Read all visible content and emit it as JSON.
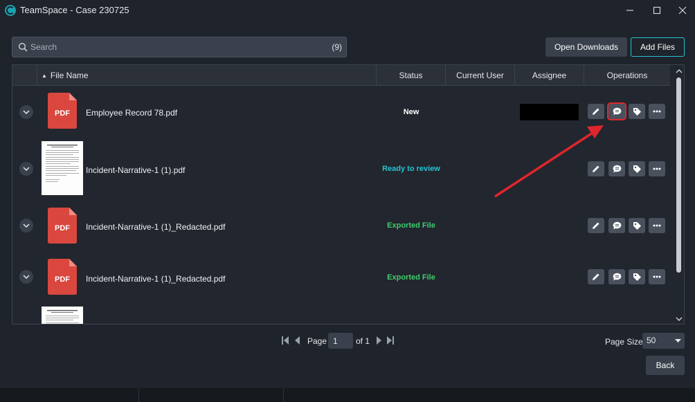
{
  "window": {
    "title": "TeamSpace - Case 230725",
    "controls": [
      "minimize",
      "maximize",
      "close"
    ]
  },
  "toolbar": {
    "search_placeholder": "Search",
    "search_count": "(9)",
    "open_downloads_label": "Open Downloads",
    "add_files_label": "Add Files"
  },
  "grid": {
    "columns": {
      "file_name": "File Name",
      "status": "Status",
      "current_user": "Current User",
      "assignee": "Assignee",
      "operations": "Operations"
    },
    "sort": "ascending",
    "rows": [
      {
        "file_name": "Employee Record 78.pdf",
        "status": "New",
        "status_color": "#ffffff",
        "thumb": "pdf-icon",
        "assignee": "redacted"
      },
      {
        "file_name": "Incident-Narrative-1 (1).pdf",
        "status": "Ready to review",
        "status_color": "#27c3d4",
        "thumb": "document-thumbnail"
      },
      {
        "file_name": "Incident-Narrative-1 (1)_Redacted.pdf",
        "status": "Exported File",
        "status_color": "#3ecf6b",
        "thumb": "pdf-icon"
      },
      {
        "file_name": "Incident-Narrative-1 (1)_Redacted.pdf",
        "status": "Exported File",
        "status_color": "#3ecf6b",
        "thumb": "pdf-icon"
      }
    ],
    "operations_icons": [
      "pencil-icon",
      "comment-icon",
      "tag-icon",
      "more-icon"
    ],
    "pdf_label": "PDF"
  },
  "pager": {
    "page_label": "Page",
    "page_value": "1",
    "of_label": "of 1",
    "page_size_label": "Page Size",
    "page_size_value": "50"
  },
  "footer": {
    "back_label": "Back"
  },
  "colors": {
    "accent": "#27c3d4",
    "highlight": "#e0262b",
    "pdf_red": "#d9473f"
  }
}
